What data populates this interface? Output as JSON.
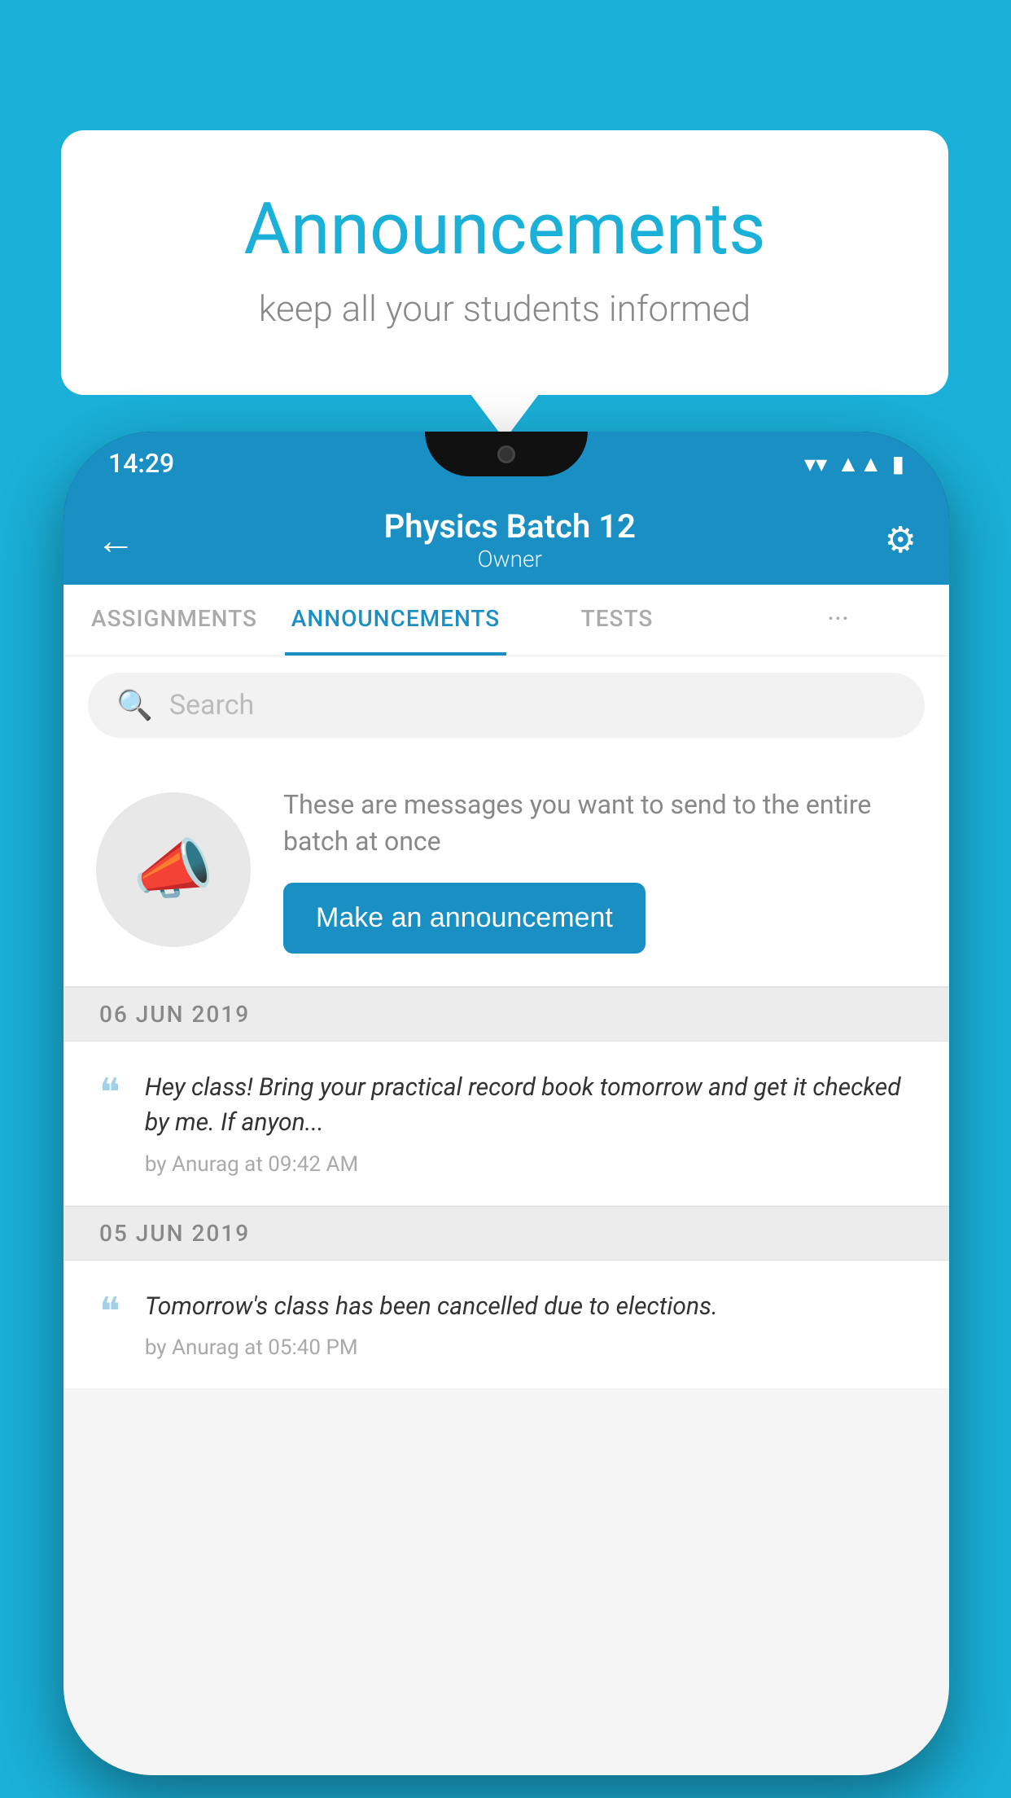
{
  "background_color": "#1ab0d8",
  "header_card": {
    "title": "Announcements",
    "subtitle": "keep all your students informed"
  },
  "phone": {
    "status_bar": {
      "time": "14:29"
    },
    "app_header": {
      "back_label": "←",
      "title": "Physics Batch 12",
      "subtitle": "Owner",
      "gear_label": "⚙"
    },
    "tabs": [
      {
        "label": "ASSIGNMENTS",
        "active": false
      },
      {
        "label": "ANNOUNCEMENTS",
        "active": true
      },
      {
        "label": "TESTS",
        "active": false
      },
      {
        "label": "···",
        "active": false
      }
    ],
    "search": {
      "placeholder": "Search"
    },
    "announcement_prompt": {
      "description": "These are messages you want to send to the entire batch at once",
      "button_label": "Make an announcement"
    },
    "announcements": [
      {
        "date": "06  JUN  2019",
        "message": "Hey class! Bring your practical record book tomorrow and get it checked by me. If anyon...",
        "meta": "by Anurag at 09:42 AM"
      },
      {
        "date": "05  JUN  2019",
        "message": "Tomorrow's class has been cancelled due to elections.",
        "meta": "by Anurag at 05:40 PM"
      }
    ]
  }
}
